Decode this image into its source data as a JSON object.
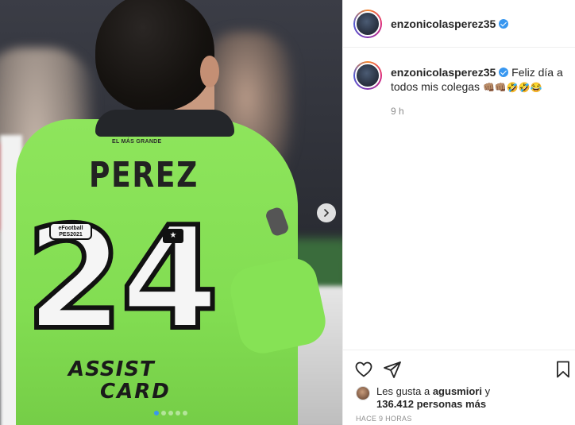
{
  "post": {
    "username": "enzonicolasperez35",
    "verified": true,
    "caption_text": "Feliz día a todos mis colegas",
    "caption_emojis": "👊🏽👊🏽🤣🤣😂",
    "time_ago": "9 h",
    "likes_prefix": "Les gusta a ",
    "likes_user": "agusmiori",
    "likes_mid": " y",
    "likes_count": "136.412",
    "likes_suffix": " personas más",
    "posted_ago": "HACE 9 HORAS"
  },
  "media": {
    "jersey_tag": "EL MÁS GRANDE",
    "jersey_name": "PEREZ",
    "jersey_number": "24",
    "sponsor_line1": "ASSIST",
    "sponsor_line2": "CARD",
    "pes_label": "eFootball PES2021",
    "jersey_color": "#8ee55c",
    "carousel_total": 5,
    "carousel_index": 1
  },
  "icons": {
    "next": "chevron-right-icon",
    "like": "heart-icon",
    "share": "send-icon",
    "save": "bookmark-icon"
  },
  "colors": {
    "accent": "#3897f0",
    "text": "#262626",
    "muted": "#8e8e8e"
  }
}
